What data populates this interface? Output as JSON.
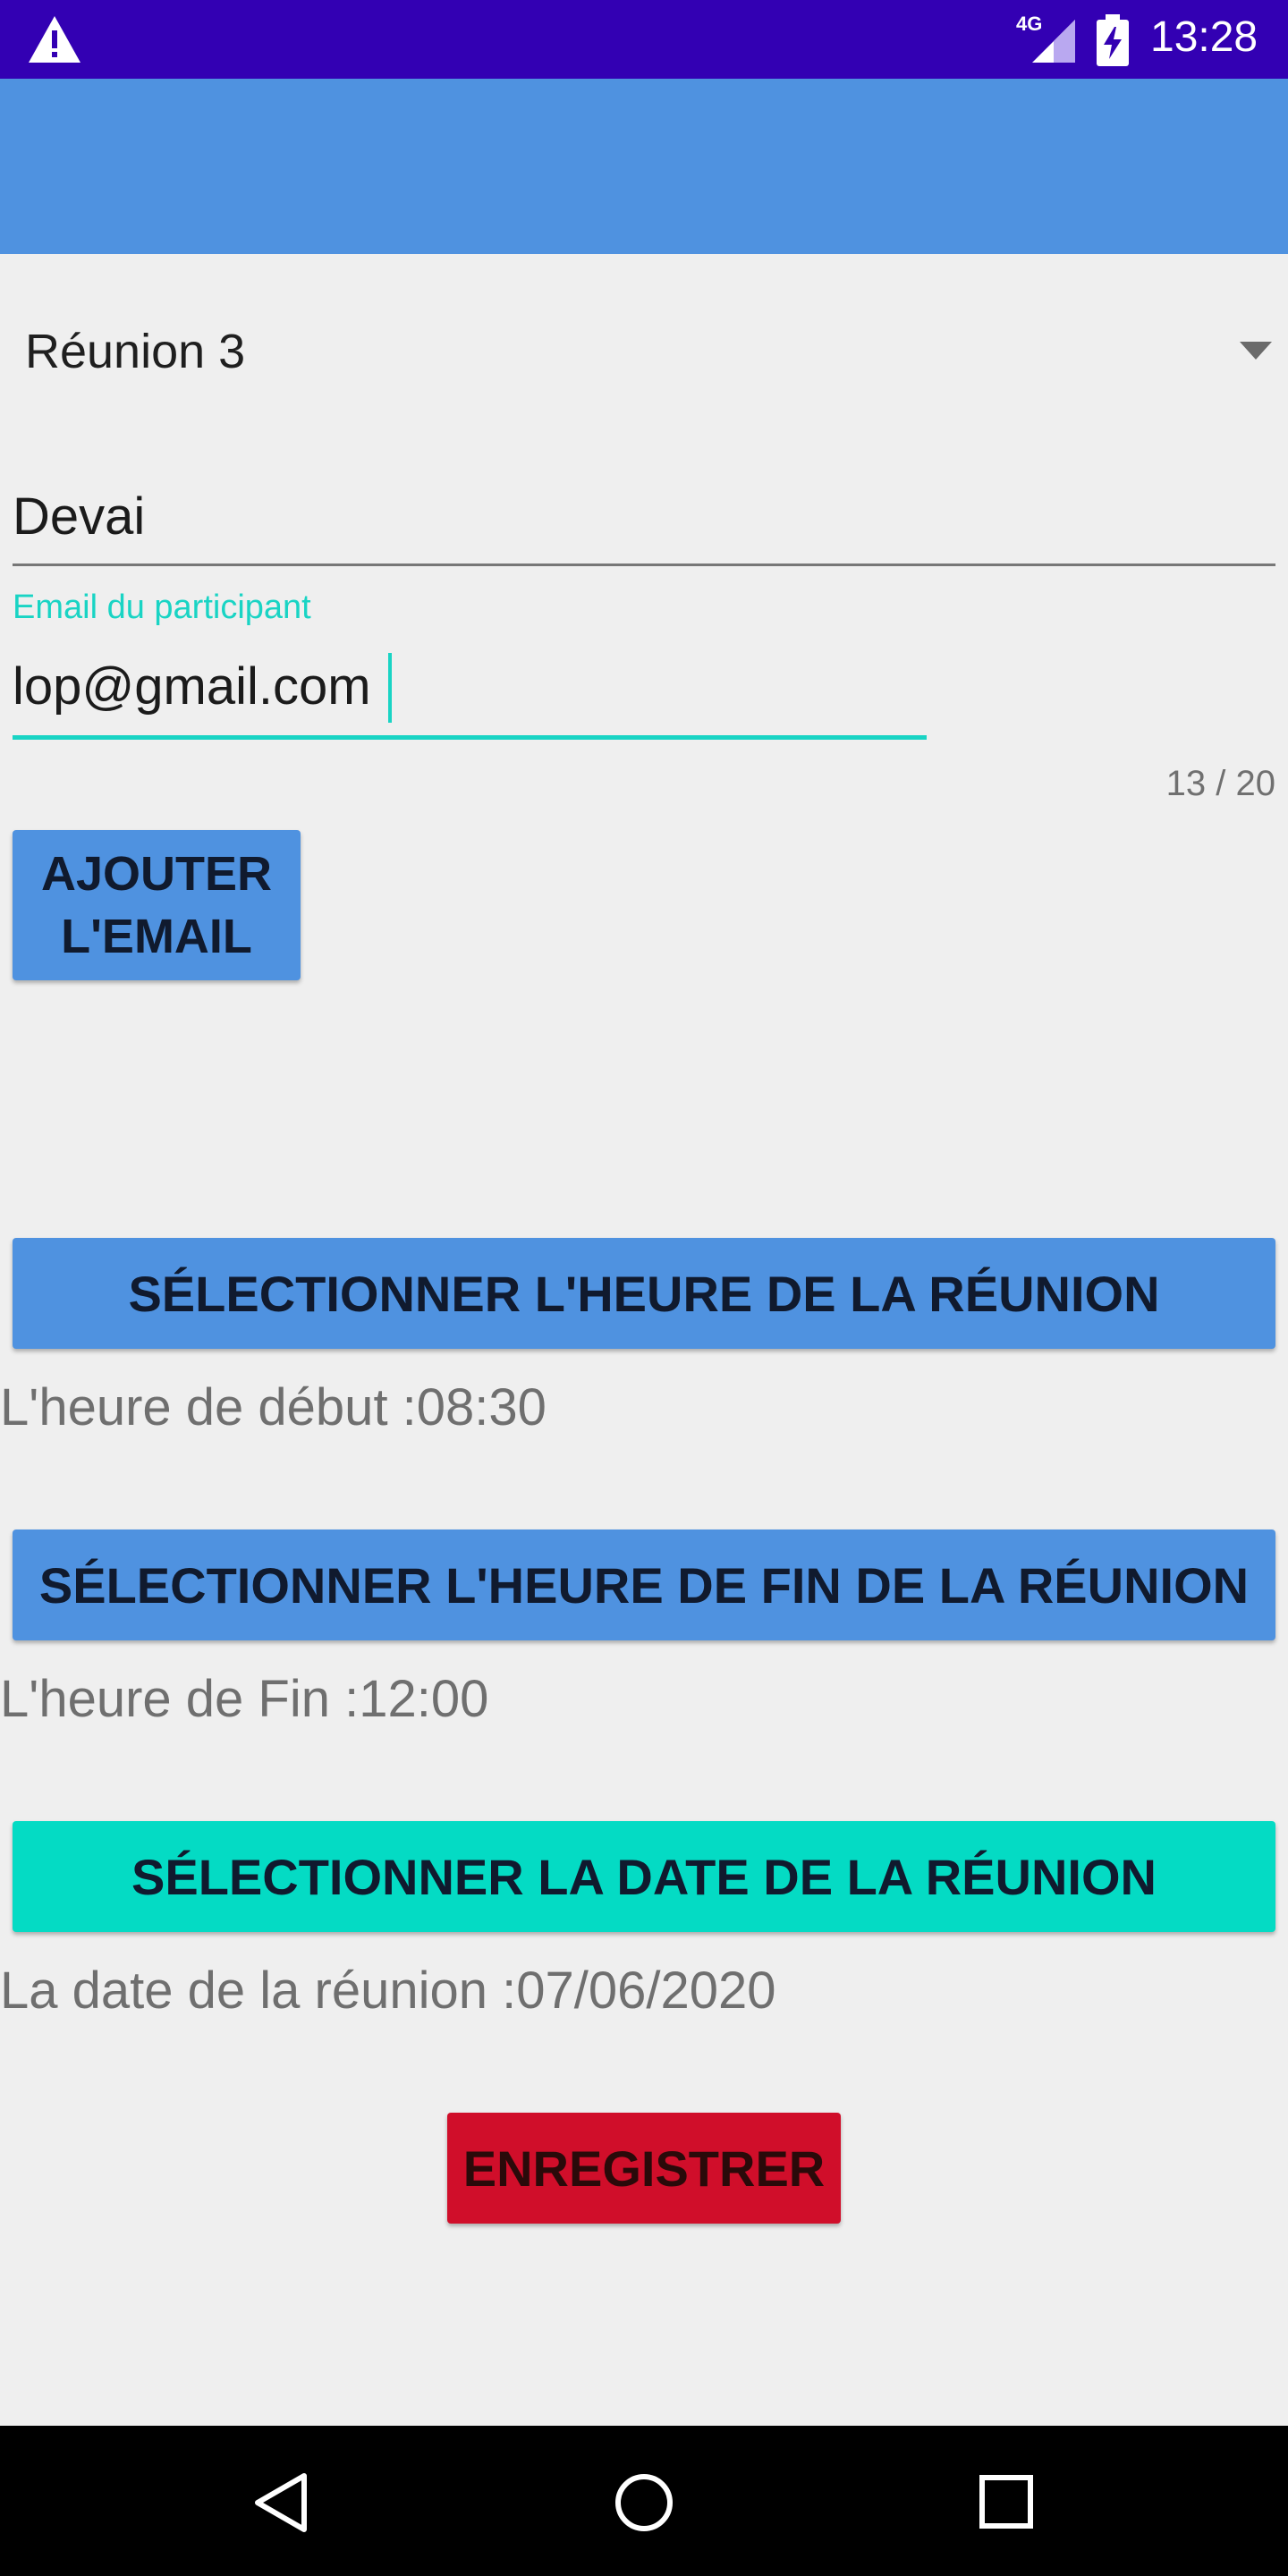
{
  "status_bar": {
    "time": "13:28",
    "network_label": "4G",
    "icons": [
      "warning-icon",
      "signal-icon",
      "battery-charging-icon"
    ]
  },
  "meeting_select": {
    "selected": "Réunion 3"
  },
  "name_field": {
    "value": "Devai"
  },
  "email_field": {
    "label": "Email du participant",
    "value": "lop@gmail.com",
    "counter": "13 / 20"
  },
  "add_email_button": {
    "line1": "AJOUTER",
    "line2": "L'EMAIL"
  },
  "start_time": {
    "button_label": "SÉLECTIONNER L'HEURE DE LA RÉUNION",
    "text": "L'heure de début :08:30"
  },
  "end_time": {
    "button_label": "SÉLECTIONNER L'HEURE DE FIN DE LA RÉUNION",
    "text": "L'heure de Fin :12:00"
  },
  "meeting_date": {
    "button_label": "SÉLECTIONNER LA DATE DE LA RÉUNION",
    "text": "La date de la réunion :07/06/2020"
  },
  "save_button": {
    "label": "ENREGISTRER"
  },
  "nav_bar": {
    "icons": [
      "back-icon",
      "home-icon",
      "recents-icon"
    ]
  },
  "colors": {
    "status_bar": "#3300b3",
    "app_bar": "#4f92e0",
    "accent": "#19d4c4",
    "date_button": "#04dbc4",
    "save_button": "#d00e2a"
  }
}
